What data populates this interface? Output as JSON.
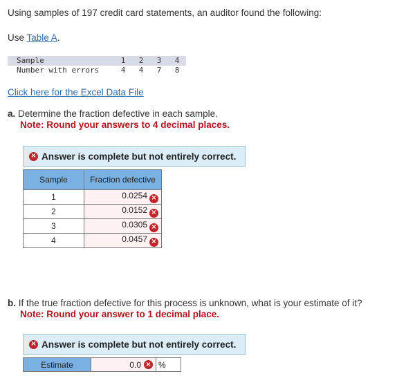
{
  "intro": "Using samples of 197 credit card statements, an auditor found the following:",
  "use_table": {
    "prefix": "Use ",
    "link": "Table A",
    "suffix": "."
  },
  "data_table": {
    "header_label": "Sample",
    "row_label": "Number with errors",
    "samples": [
      "1",
      "2",
      "3",
      "4"
    ],
    "errors": [
      "4",
      "4",
      "7",
      "8"
    ]
  },
  "excel_link": "Click here for the Excel Data File",
  "part_a": {
    "letter": "a.",
    "question": "Determine the fraction defective in each sample.",
    "note": "Note: Round your answers to 4 decimal places.",
    "banner": "Answer is complete but not entirely correct.",
    "col_sample": "Sample",
    "col_fraction": "Fraction defective",
    "rows": [
      {
        "sample": "1",
        "value": "0.0254",
        "status": "incorrect"
      },
      {
        "sample": "2",
        "value": "0.0152",
        "status": "incorrect"
      },
      {
        "sample": "3",
        "value": "0.0305",
        "status": "incorrect"
      },
      {
        "sample": "4",
        "value": "0.0457",
        "status": "incorrect"
      }
    ]
  },
  "part_b": {
    "letter": "b.",
    "question": "If the true fraction defective for this process is unknown, what is your estimate of it?",
    "note": "Note: Round your answer to 1 decimal place.",
    "banner": "Answer is complete but not entirely correct.",
    "estimate_label": "Estimate",
    "estimate_value": "0.0",
    "estimate_status": "incorrect",
    "unit": "%"
  },
  "icons": {
    "incorrect": "×"
  },
  "colors": {
    "link": "#2f6aa8",
    "note": "#b2121c",
    "error_icon": "#c4232b",
    "banner_bg": "#dcedf8",
    "header_bg": "#7ab0e4",
    "wrong_cell_bg": "#fdf1f1"
  }
}
